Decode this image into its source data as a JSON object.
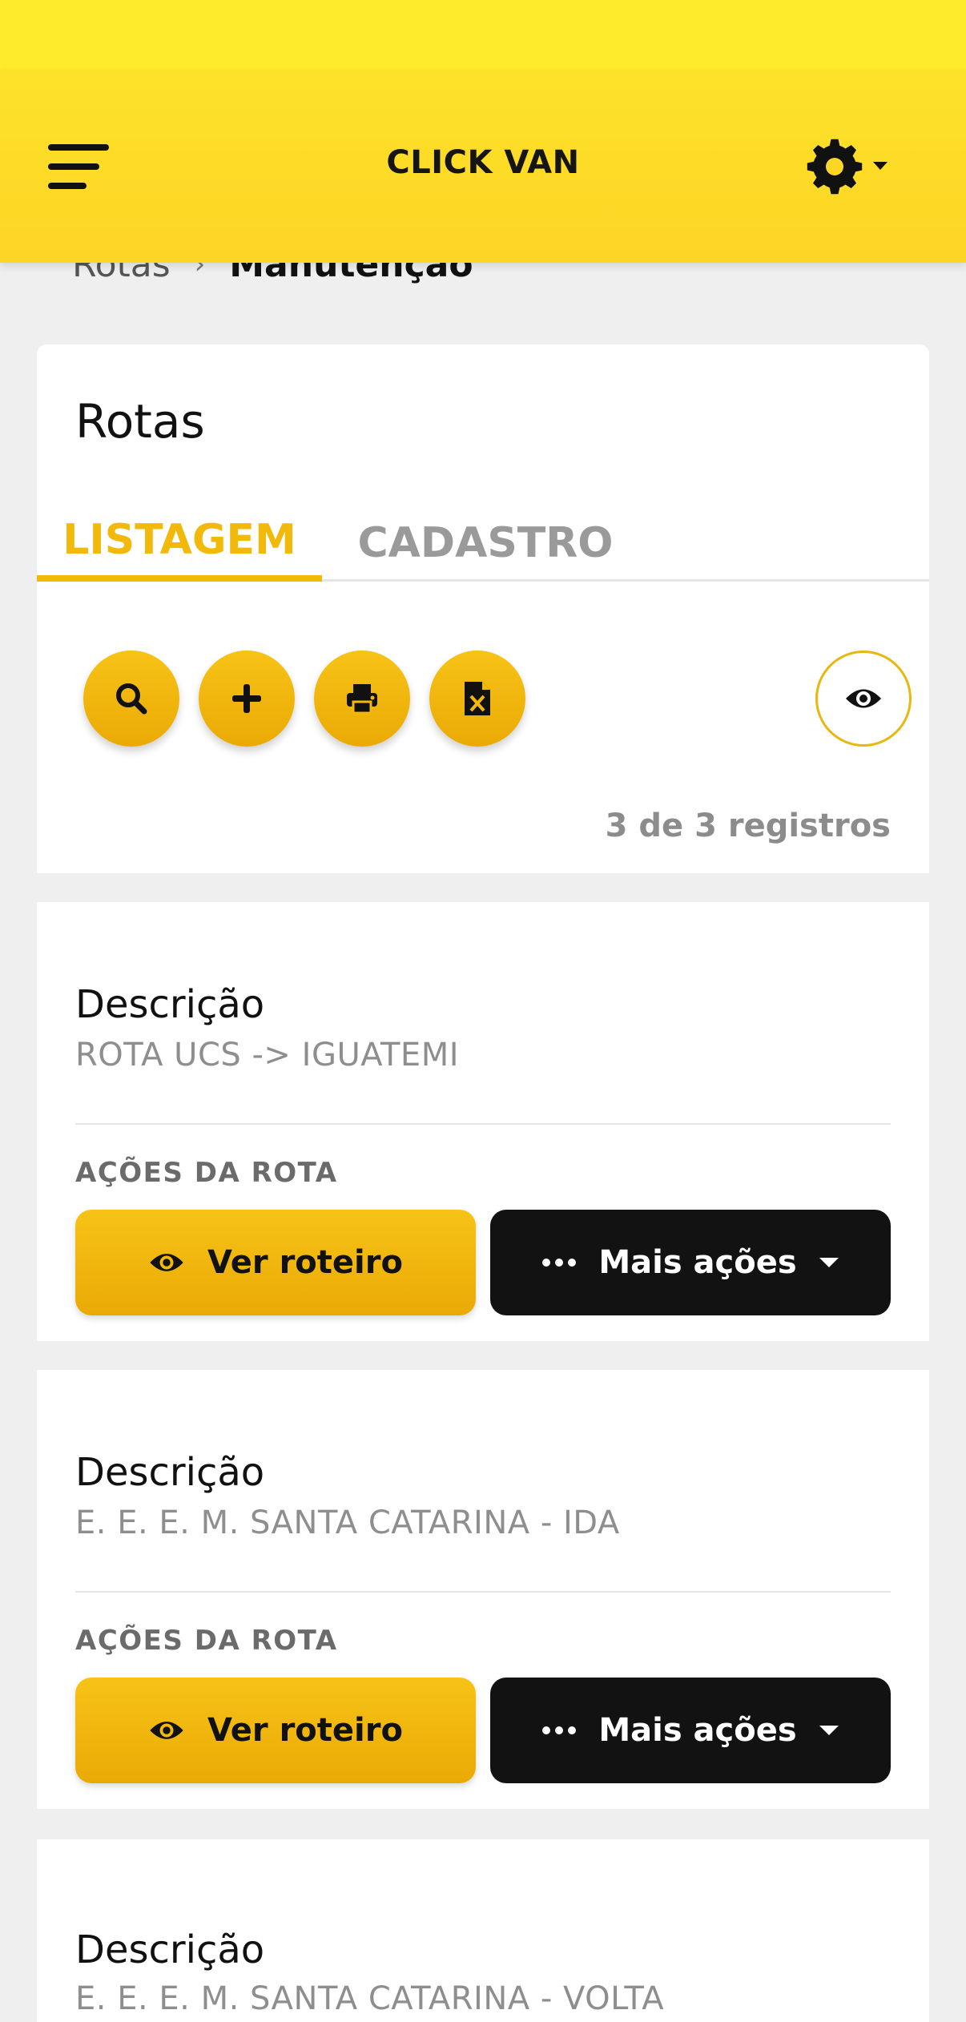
{
  "header": {
    "title": "CLICK VAN"
  },
  "breadcrumb": {
    "parent": "Rotas",
    "separator": "›",
    "current": "Manutenção"
  },
  "page": {
    "title": "Rotas",
    "tabs": [
      {
        "label": "LISTAGEM",
        "active": true
      },
      {
        "label": "CADASTRO",
        "active": false
      }
    ],
    "records_text": "3 de 3 registros"
  },
  "toolbar": {
    "icons": [
      "search-icon",
      "plus-icon",
      "print-icon",
      "excel-icon",
      "eye-icon"
    ]
  },
  "routes": [
    {
      "label": "Descrição",
      "value": "ROTA UCS -> IGUATEMI",
      "actions_label": "AÇÕES DA ROTA",
      "primary": "Ver roteiro",
      "secondary": "Mais ações"
    },
    {
      "label": "Descrição",
      "value": "E. E. E. M. SANTA CATARINA - IDA",
      "actions_label": "AÇÕES DA ROTA",
      "primary": "Ver roteiro",
      "secondary": "Mais ações"
    },
    {
      "label": "Descrição",
      "value": "E. E. E. M. SANTA CATARINA - VOLTA"
    }
  ],
  "colors": {
    "brand_yellow": "#fdd525",
    "accent": "#f2b90a",
    "dark_button": "#121212"
  }
}
